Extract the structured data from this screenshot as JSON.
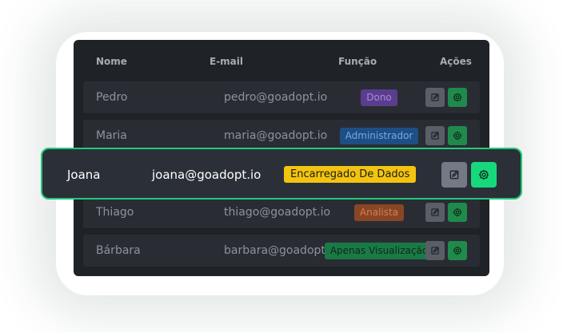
{
  "table": {
    "headers": {
      "name": "Nome",
      "email": "E-mail",
      "role": "Função",
      "actions": "Ações"
    },
    "rows": [
      {
        "name": "Pedro",
        "email": "pedro@goadopt.io",
        "role": "Dono",
        "role_color": "#5b3d8f",
        "role_text_color": "#a88ad8"
      },
      {
        "name": "Maria",
        "email": "maria@goadopt.io",
        "role": "Administrador",
        "role_color": "#1d4f86",
        "role_text_color": "#79a8de"
      },
      {
        "name": "Joana",
        "email": "joana@goadopt.io",
        "role": "Encarregado De Dados",
        "role_color": "#f2c40f",
        "role_text_color": "#1b1b1b"
      },
      {
        "name": "Thiago",
        "email": "thiago@goadopt.io",
        "role": "Analista",
        "role_color": "#8a4525",
        "role_text_color": "#d07e55"
      },
      {
        "name": "Bárbara",
        "email": "barbara@goadopt.io",
        "role": "Apenas Visualização",
        "role_color": "#1a7a45",
        "role_text_color": "#0d2a1a"
      }
    ],
    "highlighted_row": 2
  },
  "icons": {
    "edit": "edit-icon",
    "settings": "gear-icon"
  },
  "colors": {
    "card_bg": "#1f2227",
    "row_bg": "#292d33",
    "focus_border": "#24c97a",
    "gear_button": "#1f8a4c",
    "gear_button_focused": "#16d97b"
  }
}
